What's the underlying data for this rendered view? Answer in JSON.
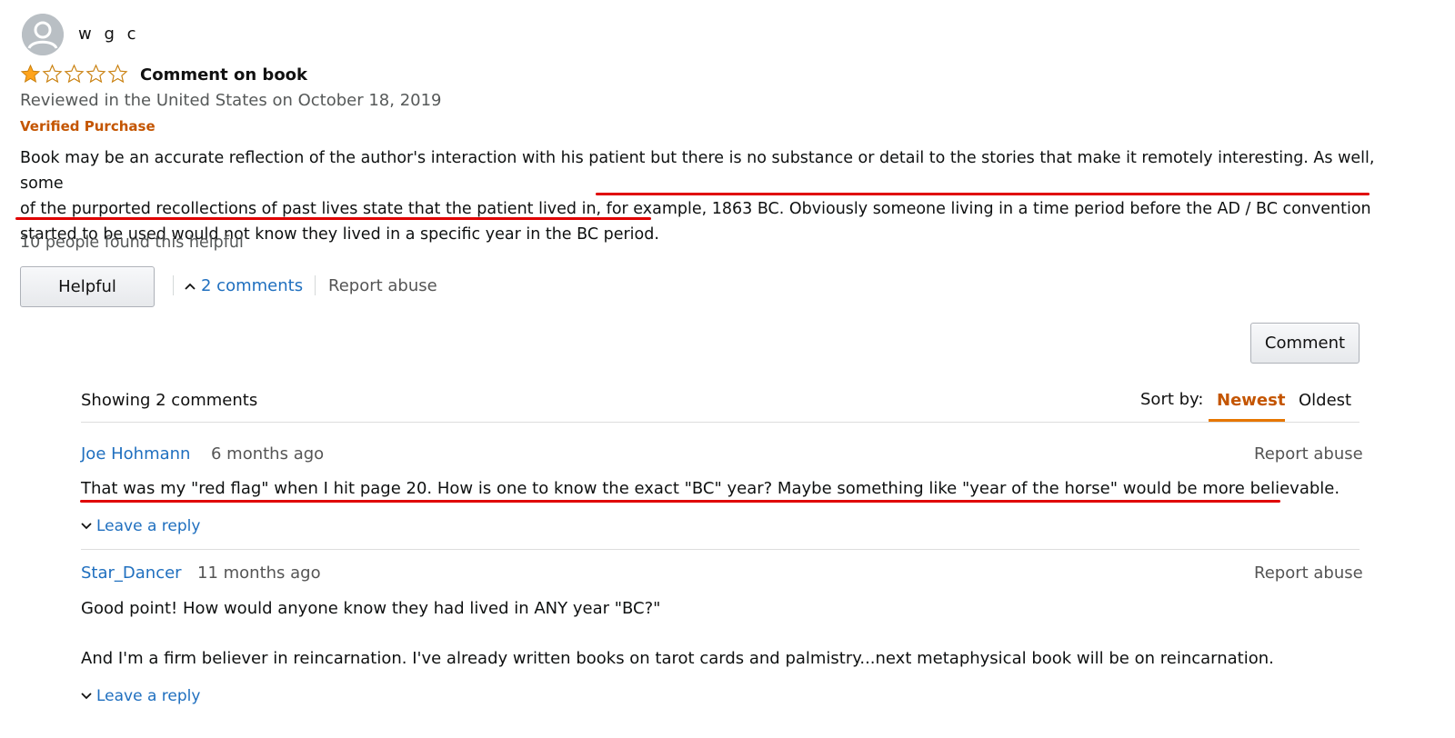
{
  "review": {
    "reviewer_name": "w g c",
    "avatar_icon": "user-avatar-icon",
    "rating": 1,
    "rating_max": 5,
    "star_color": "#ffa41c",
    "title": "Comment on book",
    "date_line": "Reviewed in the United States on October 18, 2019",
    "verified_label": "Verified Purchase",
    "body_lines": [
      "Book may be an accurate reflection of the author's interaction with his patient but there is no substance or detail to the stories that make it remotely interesting. As well, some",
      "of the purported recollections of past lives state that the patient lived in, for example, 1863 BC. Obviously someone living in a time period before the AD / BC convention",
      "started to be used would not know they lived in a specific year in the BC period."
    ],
    "helpful_count": "10 people found this helpful",
    "helpful_button": "Helpful",
    "comments_link": "2 comments",
    "report_abuse": "Report abuse"
  },
  "comments_section": {
    "comment_button": "Comment",
    "showing": "Showing 2 comments",
    "sort_label": "Sort by:",
    "sort_options": [
      "Newest",
      "Oldest"
    ],
    "selected_sort": "Newest",
    "accent_color": "#c45500",
    "comments": [
      {
        "author": "Joe Hohmann",
        "time": "6 months ago",
        "report": "Report abuse",
        "paragraphs": [
          "That was my \"red flag\" when I hit page 20. How is one to know the exact \"BC\" year? Maybe something like \"year of the horse\" would be more believable."
        ],
        "reply": "Leave a reply"
      },
      {
        "author": "Star_Dancer",
        "time": "11 months ago",
        "report": "Report abuse",
        "paragraphs": [
          "Good point! How would anyone know they had lived in ANY year \"BC?\"",
          "And I'm a firm believer in reincarnation. I've already written books on tarot cards and palmistry...next metaphysical book will be on reincarnation."
        ],
        "reply": "Leave a reply"
      }
    ]
  },
  "annotation_color": "#e00000"
}
